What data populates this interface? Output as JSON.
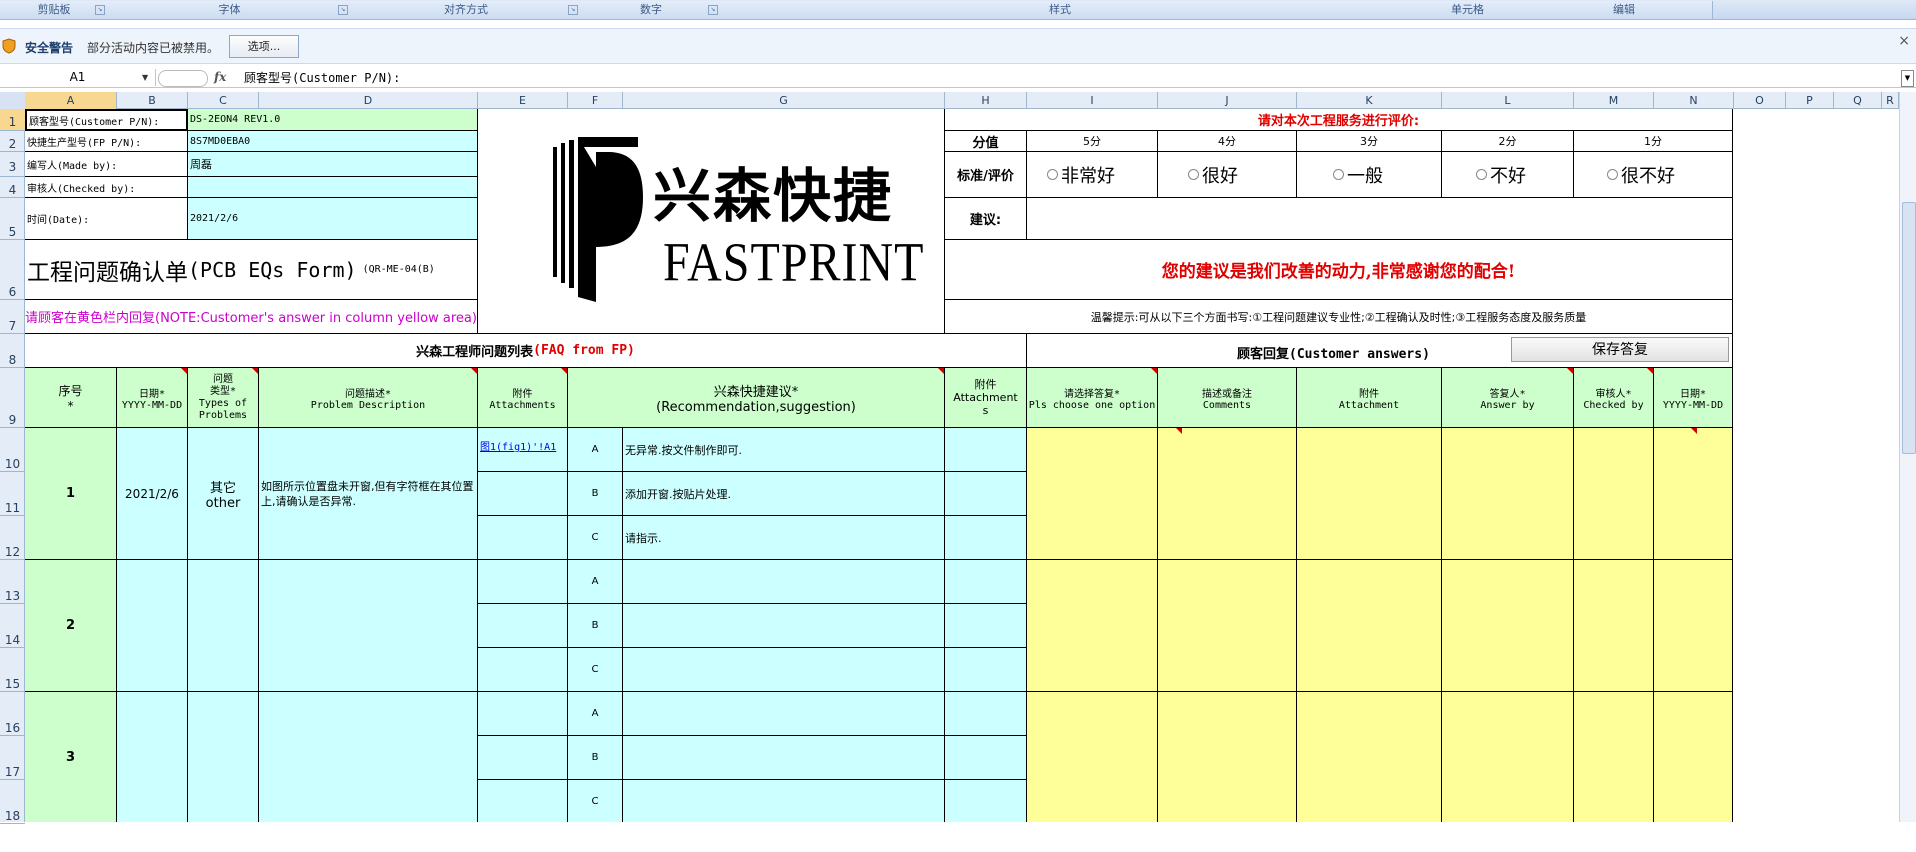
{
  "ribbon": {
    "groups": [
      "剪贴板",
      "字体",
      "对齐方式",
      "数字",
      "样式",
      "单元格",
      "编辑"
    ]
  },
  "security_bar": {
    "title": "安全警告",
    "message": "部分活动内容已被禁用。",
    "options_button": "选项...",
    "close_glyph": "×"
  },
  "formula_bar": {
    "name_box": "A1",
    "fx_label": "fx",
    "content": "顾客型号(Customer P/N):"
  },
  "columns": [
    "A",
    "B",
    "C",
    "D",
    "E",
    "F",
    "G",
    "H",
    "I",
    "J",
    "K",
    "L",
    "M",
    "N",
    "O",
    "P",
    "Q",
    "R"
  ],
  "rows": [
    "1",
    "2",
    "3",
    "4",
    "5",
    "6",
    "7",
    "8",
    "9",
    "10",
    "11",
    "12",
    "13",
    "14",
    "15",
    "16",
    "17",
    "18"
  ],
  "info": {
    "customer_pn_label": "顾客型号(Customer P/N):",
    "customer_pn_value": "DS-2EON4 REV1.0",
    "fp_pn_label": "快捷生产型号(FP P/N):",
    "fp_pn_value": "8S7MD0EBA0",
    "made_by_label": "编写人(Made by):",
    "made_by_value": "周磊",
    "checked_by_label": "审核人(Checked by):",
    "checked_by_value": "",
    "date_label": "时间(Date):",
    "date_value": "2021/2/6"
  },
  "form_title": "工程问题确认单",
  "form_title_en": "(PCB EQs Form)",
  "form_code": "(QR-ME-04(B)",
  "note": "请顾客在黄色栏内回复(NOTE:Customer's answer in column yellow area)",
  "logo": {
    "cn": "兴森快捷",
    "en": "FASTPRINT"
  },
  "rating": {
    "title": "请对本次工程服务进行评价:",
    "score_label": "分值",
    "scores": [
      "5分",
      "4分",
      "3分",
      "2分",
      "1分"
    ],
    "standard_label": "标准/评价",
    "options": [
      "非常好",
      "很好",
      "一般",
      "不好",
      "很不好"
    ],
    "suggestion_label": "建议:",
    "thanks": "您的建议是我们改善的动力,非常感谢您的配合!",
    "tip": "温馨提示:可从以下三个方面书写:①工程问题建议专业性;②工程确认及时性;③工程服务态度及服务质量"
  },
  "section_fp": {
    "title": "兴森工程师问题列表",
    "title_en": "(FAQ from FP)"
  },
  "section_customer": {
    "title": "顾客回复",
    "title_en": "(Customer answers)",
    "save_button": "保存答复"
  },
  "headers": {
    "no": [
      "序号",
      "*"
    ],
    "date": [
      "日期*",
      "YYYY-MM-DD"
    ],
    "type": [
      "问题",
      "类型*",
      "Types of",
      "Problems"
    ],
    "desc": [
      "问题描述*",
      "Problem Description"
    ],
    "attach": [
      "附件",
      "Attachments"
    ],
    "recommend": [
      "兴森快捷建议*",
      "(Recommendation,suggestion)"
    ],
    "attach2": [
      "附件",
      "Attachment",
      "s"
    ],
    "choose": [
      "请选择答复*",
      "Pls choose one option"
    ],
    "comments": [
      "描述或备注",
      "Comments"
    ],
    "attachment": [
      "附件",
      "Attachment"
    ],
    "answer_by": [
      "答复人*",
      "Answer by"
    ],
    "checked_by": [
      "审核人*",
      "Checked by"
    ],
    "date2": [
      "日期*",
      "YYYY-MM-DD"
    ]
  },
  "problems": [
    {
      "no": "1",
      "date": "2021/2/6",
      "type": "其它",
      "type_en": "other",
      "desc": "如图所示位置盘未开窗,但有字符框在其位置上,请确认是否异常.",
      "attachment_link": "图1(fig1)'!A1",
      "options": [
        {
          "letter": "A",
          "text": "无异常.按文件制作即可."
        },
        {
          "letter": "B",
          "text": "添加开窗.按贴片处理."
        },
        {
          "letter": "C",
          "text": "请指示."
        }
      ]
    },
    {
      "no": "2",
      "date": "",
      "type": "",
      "type_en": "",
      "desc": "",
      "attachment_link": "",
      "options": [
        {
          "letter": "A",
          "text": ""
        },
        {
          "letter": "B",
          "text": ""
        },
        {
          "letter": "C",
          "text": ""
        }
      ]
    },
    {
      "no": "3",
      "date": "",
      "type": "",
      "type_en": "",
      "desc": "",
      "attachment_link": "",
      "options": [
        {
          "letter": "A",
          "text": ""
        },
        {
          "letter": "B",
          "text": ""
        },
        {
          "letter": "C",
          "text": ""
        }
      ]
    }
  ],
  "colors": {
    "green": "#ccffcc",
    "cyan": "#ccffff",
    "yellow": "#ffff99",
    "red_text": "#e00000",
    "magenta_text": "#cc00cc"
  }
}
